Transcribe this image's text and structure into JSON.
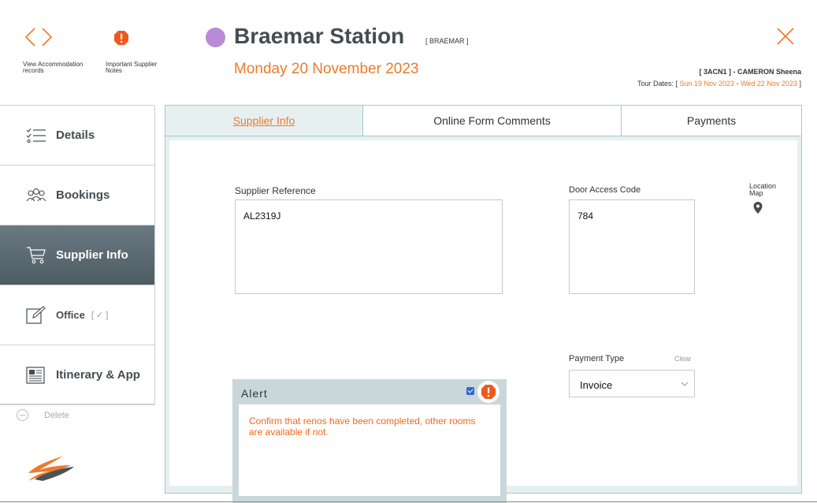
{
  "header": {
    "nav_caption": "View Accommodation records",
    "notes_caption": "Important Supplier Notes",
    "station_name": "Braemar Station",
    "station_code": "[ BRAEMAR ]",
    "date": "Monday 20 November 2023",
    "tour_code": "[ 3ACN1 ] - CAMERON Sheena",
    "tour_dates_prefix": "Tour Dates: [",
    "tour_start": "Sun 19 Nov 2023",
    "tour_sep": "-",
    "tour_end": "Wed 22 Nov 2023",
    "tour_dates_suffix": "]",
    "status_color": "#b98bd6"
  },
  "sidebar": {
    "items": [
      {
        "label": "Details",
        "icon": "list-check-icon"
      },
      {
        "label": "Bookings",
        "icon": "group-icon"
      },
      {
        "label": "Supplier Info",
        "icon": "cart-icon"
      },
      {
        "label": "Office",
        "icon": "edit-icon",
        "check": "[ ✓ ]"
      },
      {
        "label": "Itinerary & App",
        "icon": "newspaper-icon"
      }
    ],
    "delete_label": "Delete"
  },
  "tabs": [
    {
      "label": "Supplier Info"
    },
    {
      "label": "Online Form Comments"
    },
    {
      "label": "Payments"
    }
  ],
  "supplier": {
    "reference_label": "Supplier Reference",
    "reference_value": "AL2319J",
    "door_label": "Door Access Code",
    "door_value": "784",
    "location_label": "Location Map"
  },
  "alert": {
    "title": "Alert",
    "checked": true,
    "message": "Confirm that renos have been completed, other rooms are available if not."
  },
  "payment": {
    "label": "Payment Type",
    "clear_label": "Clear",
    "value": "Invoice"
  },
  "colors": {
    "accent": "#ee7a2b",
    "alert_icon": "#ee5a1c",
    "panel_border": "#a9c4c8"
  }
}
